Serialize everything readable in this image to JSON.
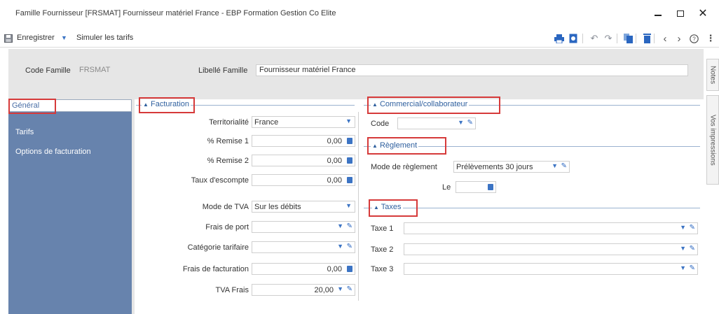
{
  "window": {
    "title": "Famille Fournisseur [FRSMAT] Fournisseur matériel France - EBP Formation Gestion Co Elite"
  },
  "toolbar": {
    "save_label": "Enregistrer",
    "simulate_label": "Simuler les tarifs"
  },
  "header": {
    "code_label": "Code Famille",
    "code_value": "FRSMAT",
    "libelle_label": "Libellé Famille",
    "libelle_value": "Fournisseur matériel France"
  },
  "right_tabs": [
    "Notes",
    "Vos impressions"
  ],
  "sidebar": {
    "items": [
      {
        "label": "Général",
        "selected": true
      },
      {
        "label": "Tarifs",
        "selected": false
      },
      {
        "label": "Options de facturation",
        "selected": false
      }
    ]
  },
  "facturation": {
    "title": "Facturation",
    "territorialite": {
      "label": "Territorialité",
      "value": "France"
    },
    "remise1": {
      "label": "% Remise 1",
      "value": "0,00"
    },
    "remise2": {
      "label": "% Remise 2",
      "value": "0,00"
    },
    "escompte": {
      "label": "Taux d'escompte",
      "value": "0,00"
    },
    "mode_tva": {
      "label": "Mode de TVA",
      "value": "Sur les débits"
    },
    "frais_port": {
      "label": "Frais de port",
      "value": ""
    },
    "categorie": {
      "label": "Catégorie tarifaire",
      "value": ""
    },
    "frais_facturation": {
      "label": "Frais de facturation",
      "value": "0,00"
    },
    "tva_frais": {
      "label": "TVA Frais",
      "value": "20,00"
    }
  },
  "commercial": {
    "title": "Commercial/collaborateur",
    "code_label": "Code",
    "code_value": ""
  },
  "reglement": {
    "title": "Règlement",
    "mode_label": "Mode de règlement",
    "mode_value": "Prélèvements 30 jours",
    "le_label": "Le",
    "le_value": ""
  },
  "taxes": {
    "title": "Taxes",
    "items": [
      {
        "label": "Taxe 1",
        "value": ""
      },
      {
        "label": "Taxe 2",
        "value": ""
      },
      {
        "label": "Taxe 3",
        "value": ""
      }
    ]
  },
  "colors": {
    "sidebar_bg": "#6783ad",
    "accent": "#3c74c4",
    "highlight_box": "#d63a3a",
    "group_title": "#2e5f9e"
  }
}
